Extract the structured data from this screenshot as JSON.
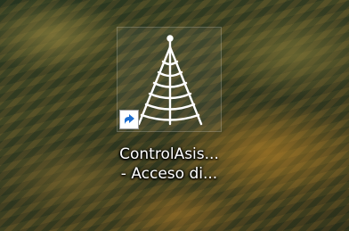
{
  "desktop": {
    "icon": {
      "label_line1": "ControlAsis...",
      "label_line2": "- Acceso di...",
      "icon_name": "radio-tower-icon",
      "overlay_icon_name": "shortcut-arrow-icon",
      "colors": {
        "tower": "#ffffff",
        "arrow": "#1e6fd0"
      }
    }
  }
}
